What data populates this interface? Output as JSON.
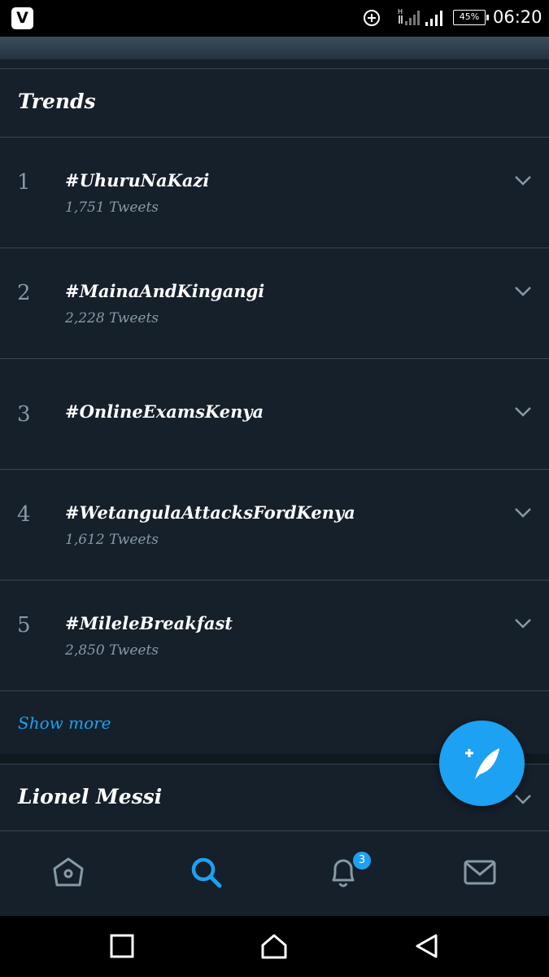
{
  "status_bar": {
    "app_badge": "V",
    "battery": "45%",
    "time": "06:20"
  },
  "trends": {
    "title": "Trends",
    "items": [
      {
        "rank": "1",
        "name": "#UhuruNaKazi",
        "count": "1,751 Tweets"
      },
      {
        "rank": "2",
        "name": "#MainaAndKingangi",
        "count": "2,228 Tweets"
      },
      {
        "rank": "3",
        "name": "#OnlineExamsKenya",
        "count": ""
      },
      {
        "rank": "4",
        "name": "#WetangulaAttacksFordKenya",
        "count": "1,612 Tweets"
      },
      {
        "rank": "5",
        "name": "#MileleBreakfast",
        "count": "2,850 Tweets"
      }
    ],
    "show_more": "Show more"
  },
  "next_section": {
    "title": "Lionel Messi"
  },
  "tab_bar": {
    "tabs": [
      {
        "icon": "home-icon",
        "active": false
      },
      {
        "icon": "search-icon",
        "active": true
      },
      {
        "icon": "bell-icon",
        "active": false
      },
      {
        "icon": "mail-icon",
        "active": false
      }
    ],
    "notifications_badge": "3"
  },
  "colors": {
    "background": "#15202b",
    "accent": "#1da1f2",
    "secondary_text": "#8899a6",
    "divider": "#38444d"
  },
  "system_nav": [
    "recent-apps-icon",
    "home-icon",
    "back-icon"
  ]
}
